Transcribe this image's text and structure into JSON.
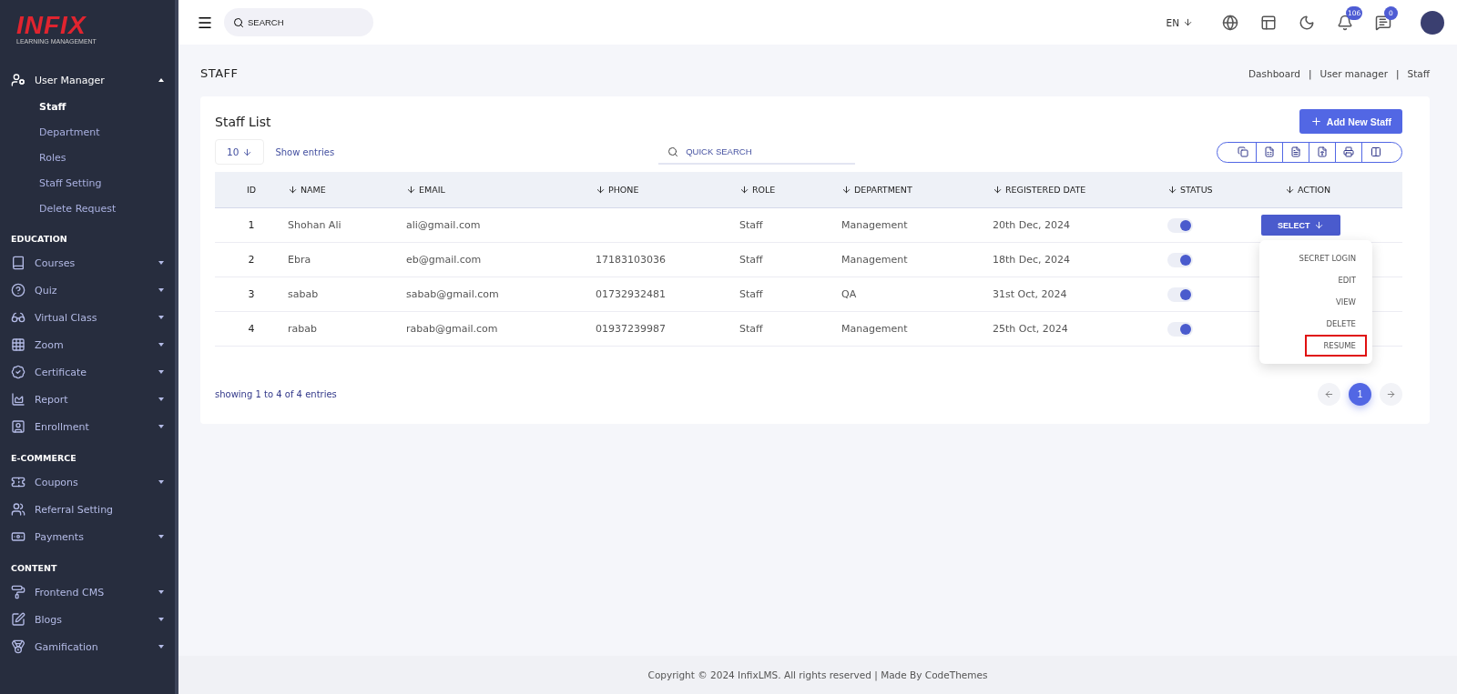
{
  "logo": {
    "name": "INFIX",
    "tagline": "LEARNING MANAGEMENT"
  },
  "sidebar": {
    "sections": [
      {
        "items": [
          {
            "label": "User Manager",
            "has_caret": true,
            "expanded": true,
            "children": [
              {
                "label": "Staff",
                "selected": true
              },
              {
                "label": "Department",
                "selected": false
              },
              {
                "label": "Roles",
                "selected": false
              },
              {
                "label": "Staff Setting",
                "selected": false
              },
              {
                "label": "Delete Request",
                "selected": false
              }
            ]
          }
        ]
      },
      {
        "heading": "EDUCATION",
        "items": [
          {
            "label": "Courses",
            "has_caret": true,
            "expanded": false
          },
          {
            "label": "Quiz",
            "has_caret": true,
            "expanded": false
          },
          {
            "label": "Virtual Class",
            "has_caret": true,
            "expanded": false
          },
          {
            "label": "Zoom",
            "has_caret": true,
            "expanded": false
          },
          {
            "label": "Certificate",
            "has_caret": true,
            "expanded": false
          },
          {
            "label": "Report",
            "has_caret": true,
            "expanded": false
          },
          {
            "label": "Enrollment",
            "has_caret": true,
            "expanded": false
          }
        ]
      },
      {
        "heading": "E-COMMERCE",
        "items": [
          {
            "label": "Coupons",
            "has_caret": true,
            "expanded": false
          },
          {
            "label": "Referral Setting",
            "has_caret": false,
            "expanded": false
          },
          {
            "label": "Payments",
            "has_caret": true,
            "expanded": false
          }
        ]
      },
      {
        "heading": "CONTENT",
        "items": [
          {
            "label": "Frontend CMS",
            "has_caret": true,
            "expanded": false
          },
          {
            "label": "Blogs",
            "has_caret": true,
            "expanded": false
          },
          {
            "label": "Gamification",
            "has_caret": true,
            "expanded": false
          }
        ]
      }
    ]
  },
  "topbar": {
    "search": {
      "placeholder": "SEARCH"
    },
    "language": "EN",
    "notifications": "106",
    "messages": "0"
  },
  "page": {
    "title": "STAFF",
    "breadcrumb": [
      "Dashboard",
      "User manager",
      "Staff"
    ],
    "separator": "|"
  },
  "card": {
    "title": "Staff List",
    "add_button": "Add New Staff",
    "entries": "10",
    "entries_label": "Show entries",
    "quick_search": {
      "placeholder": "QUICK SEARCH"
    },
    "columns": [
      {
        "label": "ID",
        "sortable": false
      },
      {
        "label": "NAME",
        "sortable": true
      },
      {
        "label": "EMAIL",
        "sortable": true
      },
      {
        "label": "PHONE",
        "sortable": true
      },
      {
        "label": "ROLE",
        "sortable": true
      },
      {
        "label": "DEPARTMENT",
        "sortable": true
      },
      {
        "label": "REGISTERED DATE",
        "sortable": true
      },
      {
        "label": "STATUS",
        "sortable": true
      },
      {
        "label": "ACTION",
        "sortable": true
      }
    ],
    "rows": [
      {
        "id": "1",
        "name": "Shohan Ali",
        "email": "ali@gmail.com",
        "phone": null,
        "role": "Staff",
        "department": "Management",
        "date": "20th Dec, 2024",
        "on": true,
        "action": "SELECT",
        "menu": [
          {
            "label": "SECRET LOGIN",
            "highlighted": false
          },
          {
            "label": "EDIT",
            "highlighted": false
          },
          {
            "label": "VIEW",
            "highlighted": false
          },
          {
            "label": "DELETE",
            "highlighted": false
          },
          {
            "label": "RESUME",
            "highlighted": true
          }
        ]
      },
      {
        "id": "2",
        "name": "Ebra",
        "email": "eb@gmail.com",
        "phone": "17183103036",
        "role": "Staff",
        "department": "Management",
        "date": "18th Dec, 2024",
        "on": true
      },
      {
        "id": "3",
        "name": "sabab",
        "email": "sabab@gmail.com",
        "phone": "01732932481",
        "role": "Staff",
        "department": "QA",
        "date": "31st Oct, 2024",
        "on": true
      },
      {
        "id": "4",
        "name": "rabab",
        "email": "rabab@gmail.com",
        "phone": "01937239987",
        "role": "Staff",
        "department": "Management",
        "date": "25th Oct, 2024",
        "on": true
      }
    ],
    "showing": "showing 1 to 4 of 4 entries",
    "pages": [
      {
        "label": "1",
        "selected": true
      }
    ]
  },
  "footer": "Copyright © 2024 InfixLMS. All rights reserved | Made By CodeThemes"
}
